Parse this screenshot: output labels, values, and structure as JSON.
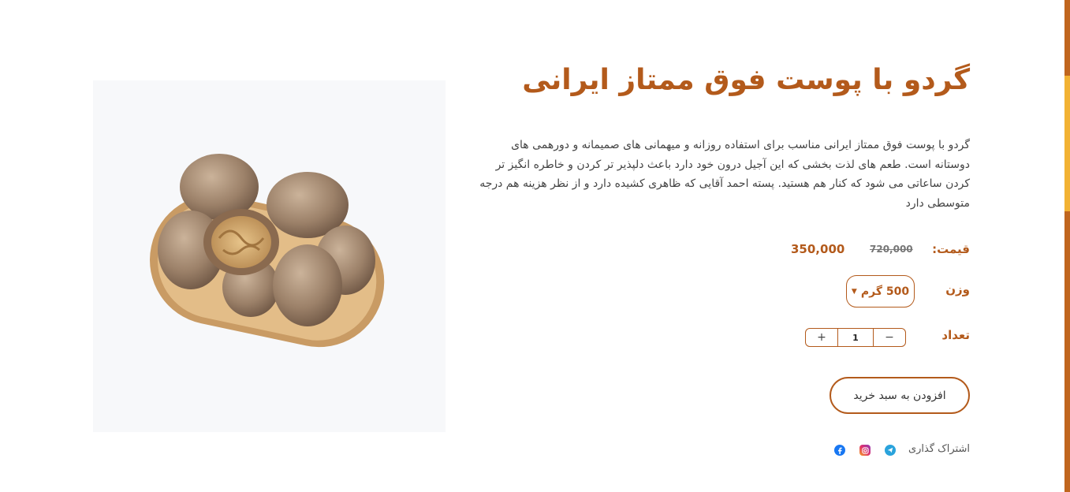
{
  "product": {
    "title": "گردو با پوست فوق ممتاز ایرانی",
    "description": "گردو با پوست فوق ممتاز ایرانی مناسب برای استفاده روزانه و میهمانی های صمیمانه و دورهمی های دوستانه است. طعم های لذت بخشی که این آجیل درون خود دارد باعث دلپذیر تر کردن و خاطره انگیز تر کردن ساعاتی می شود که کنار هم هستید. پسته احمد آقایی که ظاهری کشیده دارد و از نظر هزینه هم درجه متوسطی دارد"
  },
  "price": {
    "label": "قیمت:",
    "old": "720,000",
    "current": "350,000"
  },
  "weight": {
    "label": "وزن",
    "selected": "500 گرم"
  },
  "quantity": {
    "label": "تعداد",
    "value": "1",
    "plus": "+",
    "minus": "−"
  },
  "cart": {
    "add_label": "افزودن به سبد خرید"
  },
  "share": {
    "label": "اشتراک گذاری",
    "icons": [
      "telegram-icon",
      "instagram-icon",
      "facebook-icon"
    ]
  },
  "colors": {
    "brand": "#b35a1b",
    "accent": "#f2b233",
    "image_bg": "#f7f8fa"
  }
}
